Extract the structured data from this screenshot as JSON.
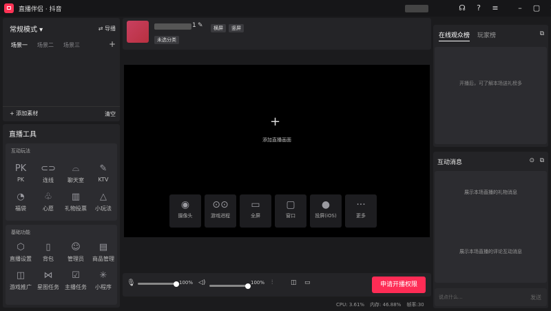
{
  "app": {
    "title": "直播伴侣 · 抖音",
    "brand_color": "#ff3355"
  },
  "titlebar": {
    "icons": [
      "headset-icon",
      "help-icon",
      "menu-icon",
      "minimize-icon",
      "maximize-icon",
      "close-icon"
    ]
  },
  "left": {
    "mode_label": "常规模式",
    "import_label": "导播",
    "scenes": [
      "场景一",
      "场景二",
      "场景三"
    ],
    "add_material": "添加素材",
    "clear": "清空",
    "tools_title": "直播工具",
    "interactive_title": "互动玩法",
    "interactive": [
      {
        "label": "PK",
        "icon": "pk-icon",
        "glyph": "PK"
      },
      {
        "label": "连线",
        "icon": "link-icon",
        "glyph": "⊂⊃"
      },
      {
        "label": "聊天室",
        "icon": "chatroom-icon",
        "glyph": "⌓"
      },
      {
        "label": "KTV",
        "icon": "mic-icon",
        "glyph": "✎"
      },
      {
        "label": "福袋",
        "icon": "lucky-bag-icon",
        "glyph": "◔"
      },
      {
        "label": "心愿",
        "icon": "wish-icon",
        "glyph": "♧"
      },
      {
        "label": "礼物投票",
        "icon": "gift-vote-icon",
        "glyph": "▥"
      },
      {
        "label": "小玩法",
        "icon": "mini-game-icon",
        "glyph": "△"
      }
    ],
    "basic_title": "基础功能",
    "basic": [
      {
        "label": "直播设置",
        "icon": "settings-icon",
        "glyph": "⬡"
      },
      {
        "label": "背包",
        "icon": "backpack-icon",
        "glyph": "▯"
      },
      {
        "label": "管理员",
        "icon": "admin-icon",
        "glyph": "☺"
      },
      {
        "label": "商品管理",
        "icon": "shop-icon",
        "glyph": "▤"
      },
      {
        "label": "游戏推广",
        "icon": "gamepad-icon",
        "glyph": "◫"
      },
      {
        "label": "星图任务",
        "icon": "star-task-icon",
        "glyph": "⋈"
      },
      {
        "label": "主播任务",
        "icon": "task-icon",
        "glyph": "☑"
      },
      {
        "label": "小程序",
        "icon": "mini-program-icon",
        "glyph": "✳"
      }
    ]
  },
  "center": {
    "username_suffix": "1",
    "orient_landscape": "横屏",
    "orient_portrait": "竖屏",
    "category": "未选分类",
    "add_screen": "添加直播画面",
    "sources": [
      {
        "label": "摄像头",
        "icon": "camera-icon",
        "glyph": "◉"
      },
      {
        "label": "游戏进程",
        "icon": "game-process-icon",
        "glyph": "⊙⊙"
      },
      {
        "label": "全屏",
        "icon": "monitor-icon",
        "glyph": "▭"
      },
      {
        "label": "窗口",
        "icon": "window-icon",
        "glyph": "▢"
      },
      {
        "label": "投屏(iOS)",
        "icon": "apple-icon",
        "glyph": "●"
      },
      {
        "label": "更多",
        "icon": "more-icon",
        "glyph": "···"
      }
    ],
    "mic_volume": "100%",
    "mic_level": 1.0,
    "speaker_volume": "100%",
    "speaker_level": 1.0,
    "start_button": "申请开播权限",
    "status": {
      "cpu": "CPU: 3.61%",
      "mem": "内存: 46.88%",
      "fps": "帧率:30"
    }
  },
  "right": {
    "tab_online": "在线观众榜",
    "tab_fans": "玩家榜",
    "online_hint": "开播后，可了解本场送礼榜多",
    "messages_title": "互动消息",
    "gift_hint": "展示本场直播的礼物消息",
    "comment_hint": "展示本场直播的评论互动消息",
    "input_placeholder": "说点什么...",
    "send": "发送"
  }
}
